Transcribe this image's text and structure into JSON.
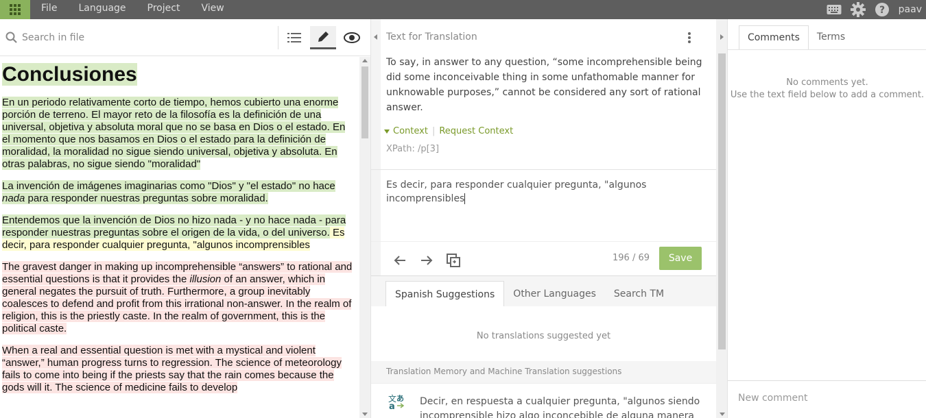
{
  "topbar": {
    "menu": [
      "File",
      "Language",
      "Project",
      "View"
    ],
    "user": "paav"
  },
  "left": {
    "search_placeholder": "Search in file",
    "doc": {
      "heading": "Conclusiones",
      "p1": [
        "En un periodo relativamente corto de tiempo, hemos cubierto una enorme porción de terreno.",
        " El mayor reto de la filosofía es la definición de una universal, objetiva y absoluta moral que no se basa en Dios o el estado.",
        " En el momento que nos basamos en Dios o el estado para la definición de moralidad, la moralidad no sigue siendo universal, objetiva y absoluta.",
        " En otras palabras, no sigue siendo \"moralidad\""
      ],
      "p2_a": "La invención de imágenes imaginarias como \"Dios\" y \"el estado\" no hace ",
      "p2_em": "nada",
      "p2_b": " para responder nuestras preguntas sobre moralidad.",
      "p3_a": "Entendemos que la invención de Dios no hizo nada - y no hace nada - para responder nuestras preguntas sobre el origen de la vida, o del universo.",
      "p3_b": " Es decir, para responder cualquier pregunta, \"algunos incomprensibles",
      "p4_a": "The gravest danger in making up incomprehensible “answers” to rational and essential questions is that it provides the ",
      "p4_em": "illusion",
      "p4_b": " of an answer, which in general negates the pursuit of truth.",
      "p4_c": " Furthermore, a group inevitably coalesces to defend and profit from this irrational non-answer.",
      "p4_d": " In the realm of religion, this is the priestly caste.",
      "p4_e": " In the realm of government, this is the political caste.",
      "p5_a": "When a real and essential question is met with a mystical and violent “answer,” human progress turns to regression.",
      "p5_b": " The science of meteorology fails to come into being if the priests say that the rain comes because the gods will it.",
      "p5_c": " The science of medicine fails to develop"
    }
  },
  "mid": {
    "header": "Text for Translation",
    "source": "To say, in answer to any question, “some incomprehensible being did some inconceivable thing in some unfathomable manner for unknowable purposes,” cannot be considered any sort of rational answer.",
    "context_label": "Context",
    "request_context": "Request Context",
    "xpath": "XPath: /p[3]",
    "target_text": "Es decir, para responder cualquier pregunta, \"algunos incomprensibles",
    "counter": "196 / 69",
    "save_label": "Save",
    "tabs": [
      "Spanish Suggestions",
      "Other Languages",
      "Search TM"
    ],
    "no_suggestions": "No translations suggested yet",
    "tm_label": "Translation Memory and Machine Translation suggestions",
    "tm_suggestion": "Decir, en respuesta a cualquier pregunta, \"algunos siendo incomprensible hizo algo inconcebible de alguna manera"
  },
  "right": {
    "tabs": [
      "Comments",
      "Terms"
    ],
    "no_comments_1": "No comments yet.",
    "no_comments_2": "Use the text field below to add a comment.",
    "comment_placeholder": "New comment"
  },
  "colors": {
    "accent": "#8ab25c",
    "save": "#9bc26b",
    "topbar": "#5e5e5e",
    "green_hl": "#d9ebc6",
    "yellow_hl": "#fefcd0",
    "red_hl": "#fce4e2"
  }
}
